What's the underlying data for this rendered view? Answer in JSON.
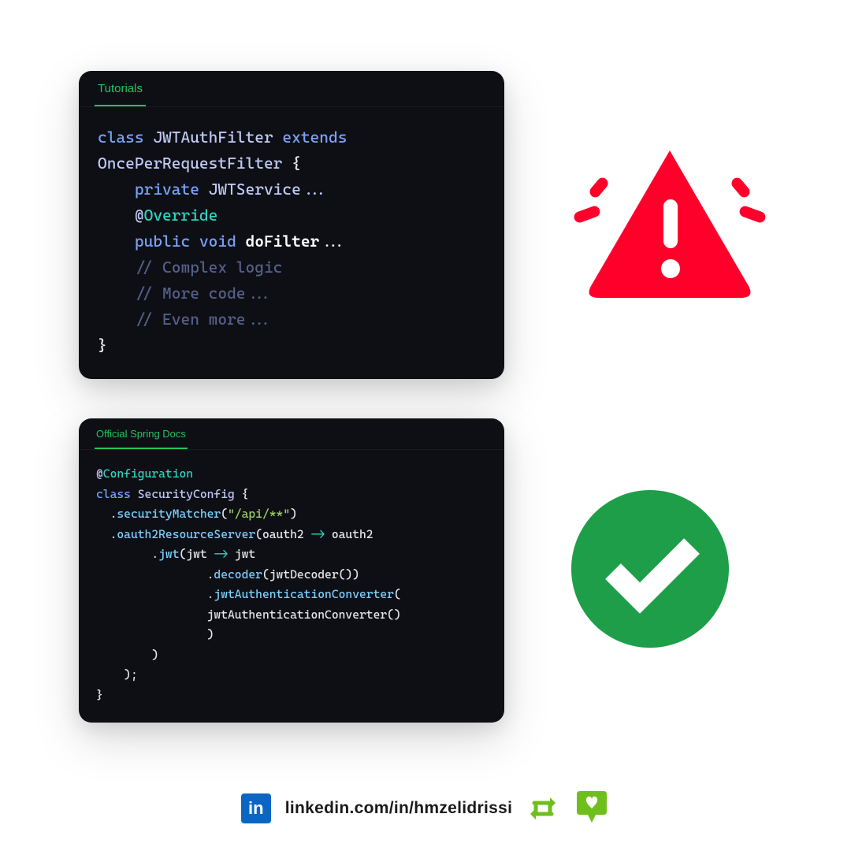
{
  "cards": {
    "top": {
      "tab": "Tutorials",
      "code": {
        "l1_kw1": "class",
        "l1_cls": "JWTAuthFilter",
        "l1_kw2": "extends",
        "l2_cls": "OncePerRequestFilter",
        "l2_brace": " {",
        "l3_kw": "private",
        "l3_rest": " JWTService...",
        "l4_at": "@",
        "l4_anno": "Override",
        "l5_kw1": "public",
        "l5_kw2": "void",
        "l5_fn": "doFilter",
        "l5_rest": "...",
        "l6_cmt": "// Complex logic",
        "l7_cmt": "// More code...",
        "l8_cmt": "// Even more...",
        "l9_brace": "}"
      }
    },
    "bottom": {
      "tab": "Official Spring Docs",
      "code": {
        "l1_at": "@",
        "l1_anno": "Configuration",
        "l2_kw": "class",
        "l2_cls": "SecurityConfig",
        "l2_brace": " {",
        "l3_dot": "  .",
        "l3_m": "securityMatcher",
        "l3_p1": "(",
        "l3_str": "\"/api/**\"",
        "l3_p2": ")",
        "l4_dot": "  .",
        "l4_m": "oauth2ResourceServer",
        "l4_p1": "(oauth2 ",
        "l4_arrow": "->",
        "l4_p2": " oauth2",
        "l5_dot": "        .",
        "l5_m": "jwt",
        "l5_p1": "(jwt ",
        "l5_arrow": "->",
        "l5_p2": " jwt",
        "l6_dot": "                .",
        "l6_m": "decoder",
        "l6_p": "(jwtDecoder())",
        "l7_dot": "                .",
        "l7_m": "jwtAuthenticationConverter",
        "l7_p": "(",
        "l8": "                jwtAuthenticationConverter()",
        "l9": "                )",
        "l10": "        )",
        "l11": "    );",
        "l12": "}"
      }
    }
  },
  "footer": {
    "linkedin_text": "in",
    "handle": "linkedin.com/in/hmzelidrissi"
  },
  "colors": {
    "warn": "#ff002b",
    "check": "#1e9e48",
    "accent_green": "#6fbf1c"
  }
}
